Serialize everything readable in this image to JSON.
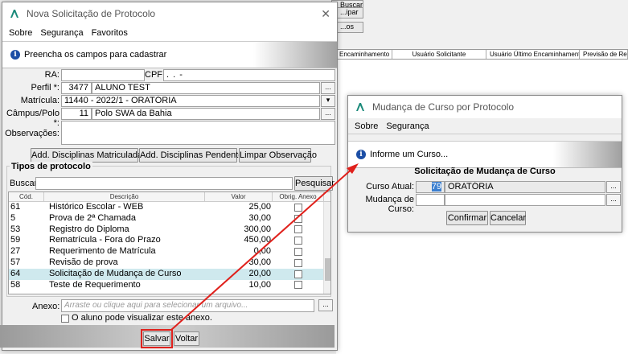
{
  "background": {
    "buttons": [
      "Buscar",
      "...ipar",
      "...os"
    ],
    "columns": [
      "Encaminhamento",
      "Usuário Solicitante",
      "Usuário Último Encaminhamento",
      "Previsão de Retor"
    ]
  },
  "main_dialog": {
    "title": "Nova Solicitação de Protocolo",
    "menu": [
      "Sobre",
      "Segurança",
      "Favoritos"
    ],
    "info": "Preencha os campos para cadastrar",
    "ra_label": "RA:",
    "ra_value": "",
    "cpf_label": "CPF:",
    "cpf_value": ".   .   -",
    "perfil_label": "Perfil *:",
    "perfil_code": "3477",
    "perfil_name": "ALUNO TEST",
    "matricula_label": "Matrícula:",
    "matricula_value": "11440 - 2022/1 - ORATÓRIA",
    "campus_label": "Câmpus/Polo *:",
    "campus_code": "11",
    "campus_name": "Polo SWA da Bahia",
    "obs_label": "Observações:",
    "btn_add_matriculadas": "Add. Disciplinas Matriculadas",
    "btn_add_pendentes": "Add. Disciplinas Pendentes",
    "btn_limpar": "Limpar Observação",
    "tipos_title": "Tipos de protocolo",
    "buscar_label": "Buscar:",
    "pesquisar": "Pesquisar",
    "grid_headers": [
      "Cód.",
      "Descrição",
      "Valor",
      "Obrig. Anexo"
    ],
    "rows": [
      {
        "cod": "61",
        "desc": "Histórico Escolar - WEB",
        "valor": "25,00"
      },
      {
        "cod": "5",
        "desc": "Prova de 2ª Chamada",
        "valor": "30,00"
      },
      {
        "cod": "53",
        "desc": "Registro do Diploma",
        "valor": "300,00"
      },
      {
        "cod": "59",
        "desc": "Rematrícula - Fora do Prazo",
        "valor": "450,00"
      },
      {
        "cod": "27",
        "desc": "Requerimento de Matrícula",
        "valor": "0,00"
      },
      {
        "cod": "57",
        "desc": "Revisão de prova",
        "valor": "30,00"
      },
      {
        "cod": "64",
        "desc": "Solicitação de Mudança de Curso",
        "valor": "20,00"
      },
      {
        "cod": "58",
        "desc": "Teste de Requerimento",
        "valor": "10,00"
      }
    ],
    "selected_row": 6,
    "anexo_label": "Anexo:",
    "anexo_placeholder": "Arraste ou clique aqui para selecionar um arquivo...",
    "visualizar_label": "O aluno pode visualizar este anexo.",
    "salvar": "Salvar",
    "voltar": "Voltar"
  },
  "second_dialog": {
    "title": "Mudança de Curso por Protocolo",
    "menu": [
      "Sobre",
      "Segurança"
    ],
    "info": "Informe um Curso...",
    "heading": "Solicitação de Mudança de Curso",
    "curso_atual_label": "Curso Atual:",
    "curso_atual_code": "79",
    "curso_atual_name": "ORATÓRIA",
    "mudanca_label": "Mudança de Curso:",
    "confirmar": "Confirmar",
    "cancelar": "Cancelar"
  },
  "colors": {
    "highlight": "#e0211c",
    "selected_row": "#cfe9ee",
    "info_icon": "#1c4ea5"
  }
}
